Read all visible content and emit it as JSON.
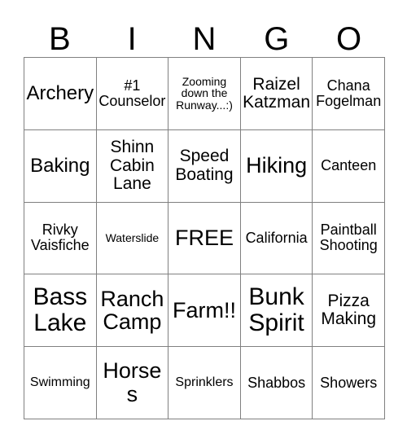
{
  "card": {
    "header": {
      "letters": [
        "B",
        "I",
        "N",
        "G",
        "O"
      ]
    },
    "columns": 5,
    "rows": 5,
    "free_space_label": "FREE",
    "cells": [
      {
        "text": "Archery",
        "size": "lg"
      },
      {
        "text": "#1\nCounselor",
        "size": "sm"
      },
      {
        "text": "Zooming\ndown the\nRunway...:)",
        "size": "xxs"
      },
      {
        "text": "Raizel\nKatzman",
        "size": "md"
      },
      {
        "text": "Chana\nFogelman",
        "size": "sm"
      },
      {
        "text": "Baking",
        "size": "lg"
      },
      {
        "text": "Shinn\nCabin\nLane",
        "size": "md"
      },
      {
        "text": "Speed\nBoating",
        "size": "md"
      },
      {
        "text": "Hiking",
        "size": "xl"
      },
      {
        "text": "Canteen",
        "size": "sm"
      },
      {
        "text": "Rivky\nVaisfiche",
        "size": "sm"
      },
      {
        "text": "Waterslide",
        "size": "xxs"
      },
      {
        "text": "FREE",
        "size": "xl"
      },
      {
        "text": "California",
        "size": "sm"
      },
      {
        "text": "Paintball\nShooting",
        "size": "sm"
      },
      {
        "text": "Bass\nLake",
        "size": "xxl"
      },
      {
        "text": "Ranch\nCamp",
        "size": "xl"
      },
      {
        "text": "Farm!!",
        "size": "xl"
      },
      {
        "text": "Bunk\nSpirit",
        "size": "xxl"
      },
      {
        "text": "Pizza\nMaking",
        "size": "md"
      },
      {
        "text": "Swimming",
        "size": "xs"
      },
      {
        "text": "Horses",
        "size": "xl"
      },
      {
        "text": "Sprinklers",
        "size": "xs"
      },
      {
        "text": "Shabbos",
        "size": "sm"
      },
      {
        "text": "Showers",
        "size": "sm"
      }
    ]
  },
  "colors": {
    "background": "#ffffff",
    "text": "#000000",
    "grid_line": "#808080"
  }
}
